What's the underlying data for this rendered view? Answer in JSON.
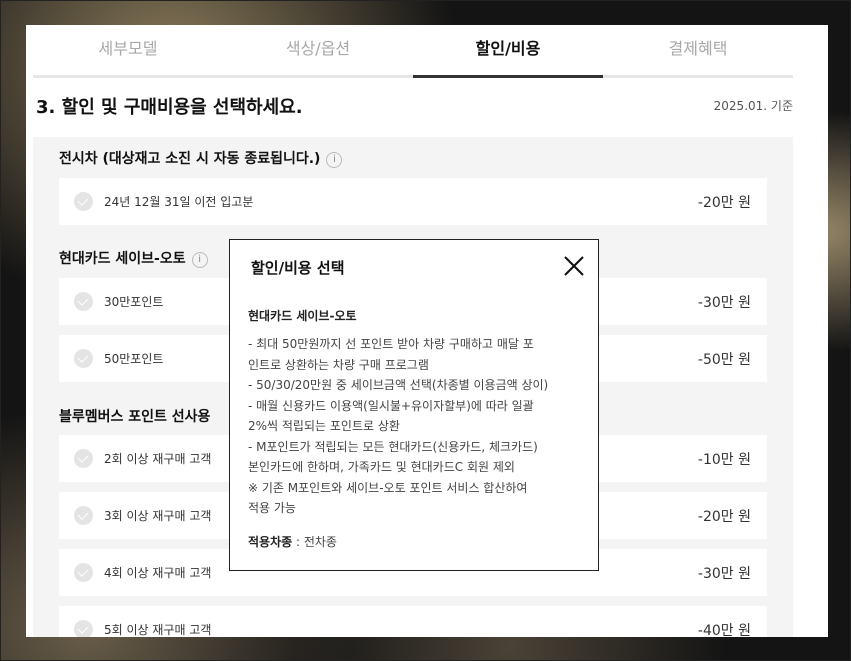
{
  "tabs": [
    {
      "label": "세부모델",
      "active": false
    },
    {
      "label": "색상/옵션",
      "active": false
    },
    {
      "label": "할인/비용",
      "active": true
    },
    {
      "label": "결제혜택",
      "active": false
    }
  ],
  "heading": "3. 할인 및 구매비용을 선택하세요.",
  "basis_date": "2025.01. 기준",
  "sections": [
    {
      "title": "전시차 (대상재고 소진 시 자동 종료됩니다.)",
      "info_icon": "info-icon",
      "rows": [
        {
          "label": "24년 12월 31일 이전 입고분",
          "price": "-20만 원"
        }
      ]
    },
    {
      "title": "현대카드 세이브-오토",
      "info_icon": "info-icon",
      "rows": [
        {
          "label": "30만포인트",
          "price": "-30만 원"
        },
        {
          "label": "50만포인트",
          "price": "-50만 원"
        }
      ]
    },
    {
      "title": "블루멤버스 포인트 선사용",
      "rows": [
        {
          "label": "2회 이상 재구매 고객",
          "price": "-10만 원"
        },
        {
          "label": "3회 이상 재구매 고객",
          "price": "-20만 원"
        },
        {
          "label": "4회 이상 재구매 고객",
          "price": "-30만 원"
        },
        {
          "label": "5회 이상 재구매 고객",
          "price": "-40만 원"
        }
      ]
    }
  ],
  "modal": {
    "title": "할인/비용 선택",
    "close_icon": "close-icon",
    "subtitle": "현대카드 세이브-오토",
    "lines": [
      "- 최대 50만원까지 선 포인트 받아 차량 구매하고 매달 포",
      "인트로 상환하는 차량 구매 프로그램",
      "- 50/30/20만원 중 세이브금액 선택(차종별 이용금액 상이)",
      "- 매월 신용카드 이용액(일시불+유이자할부)에 따라 일괄",
      "2%씩 적립되는 포인트로 상환",
      "- M포인트가 적립되는 모든 현대카드(신용카드, 체크카드)",
      "본인카드에 한하며, 가족카드 및 현대카드C 회원 제외",
      "※ 기존 M포인트와 세이브-오토 포인트 서비스 합산하여",
      "적용 가능"
    ],
    "footer_label": "적용차종",
    "footer_value": " : 전차종"
  }
}
